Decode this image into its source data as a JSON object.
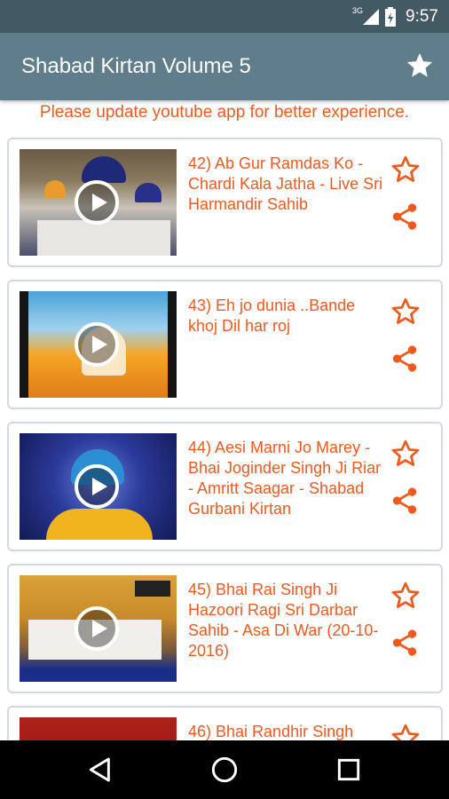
{
  "status_bar": {
    "network_label": "3G",
    "time": "9:57"
  },
  "app_bar": {
    "title": "Shabad Kirtan Volume 5",
    "star_icon": "star-icon"
  },
  "notice": "Please update youtube app for better experience.",
  "accent_color": "#f05a1e",
  "videos": [
    {
      "title": "42) Ab Gur Ramdas Ko - Chardi Kala Jatha - Live Sri Harmandir Sahib"
    },
    {
      "title": "43) Eh jo dunia ..Bande khoj Dil har roj"
    },
    {
      "title": "44) Aesi Marni Jo Marey - Bhai Joginder Singh Ji Riar - Amritt Saagar - Shabad Gurbani Kirtan"
    },
    {
      "title": "45) Bhai Rai Singh Ji Hazoori Ragi Sri Darbar Sahib - Asa Di War (20-10-2016)"
    },
    {
      "title": "46) Bhai Randhir Singh"
    }
  ],
  "nav_bar": {
    "back": "back-icon",
    "home": "home-icon",
    "recents": "recents-icon"
  }
}
